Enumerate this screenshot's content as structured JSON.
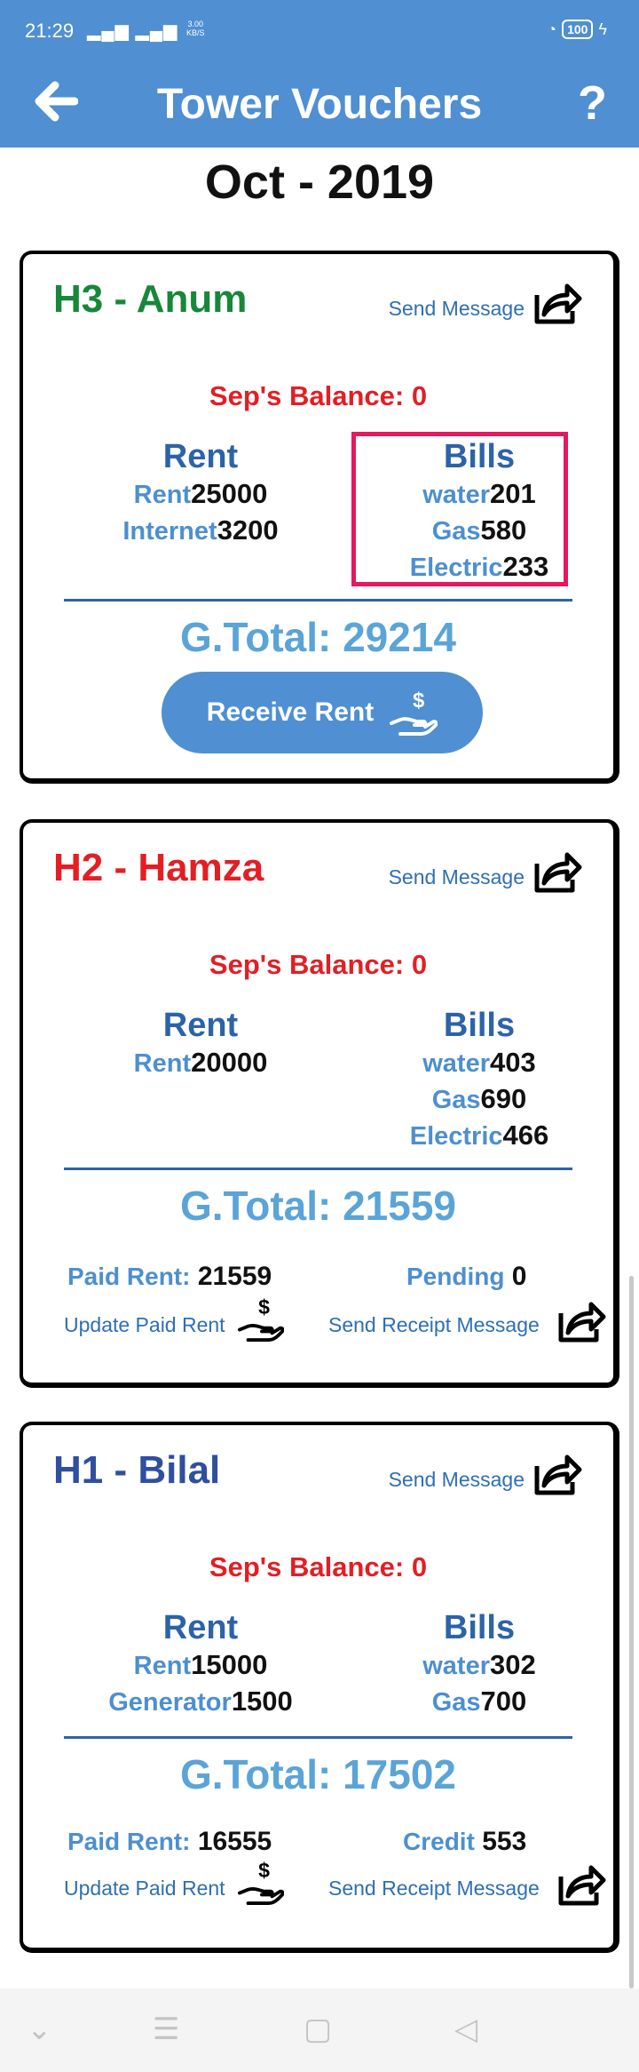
{
  "status_bar": {
    "time": "21:29",
    "speed_value": "3.00",
    "speed_unit": "KB/S",
    "battery": "100"
  },
  "app_bar": {
    "title": "Tower Vouchers",
    "back_icon": "arrow-left-icon",
    "help_label": "?"
  },
  "month": "Oct - 2019",
  "colors": {
    "primary": "#4f8fd2",
    "balance_red": "#e31e24",
    "heading_blue": "#2c63a8",
    "total_blue": "#5aa4d8",
    "highlight": "#e5195c"
  },
  "cards": [
    {
      "name": "H3 - Anum",
      "name_color": "#17873a",
      "send_message": "Send Message",
      "balance": "Sep's Balance: 0",
      "rent_head": "Rent",
      "bills_head": "Bills",
      "rent_items": [
        {
          "label": "Rent",
          "value": "25000"
        },
        {
          "label": "Internet",
          "value": "3200"
        }
      ],
      "bill_items": [
        {
          "label": "water",
          "value": "201"
        },
        {
          "label": "Gas",
          "value": "580"
        },
        {
          "label": "Electric",
          "value": "233"
        }
      ],
      "total": "G.Total: 29214",
      "receive_button": "Receive Rent"
    },
    {
      "name": "H2 - Hamza",
      "name_color": "#e31e24",
      "send_message": "Send Message",
      "balance": "Sep's Balance: 0",
      "rent_head": "Rent",
      "bills_head": "Bills",
      "rent_items": [
        {
          "label": "Rent",
          "value": "20000"
        }
      ],
      "bill_items": [
        {
          "label": "water",
          "value": "403"
        },
        {
          "label": "Gas",
          "value": "690"
        },
        {
          "label": "Electric",
          "value": "466"
        }
      ],
      "total": "G.Total: 21559",
      "paid_label": "Paid Rent:",
      "paid_value": "21559",
      "status_label": "Pending",
      "status_value": "0",
      "update_link": "Update Paid Rent",
      "receipt_link": "Send Receipt Message"
    },
    {
      "name": "H1 - Bilal",
      "name_color": "#2f4f9e",
      "send_message": "Send Message",
      "balance": "Sep's Balance: 0",
      "rent_head": "Rent",
      "bills_head": "Bills",
      "rent_items": [
        {
          "label": "Rent",
          "value": "15000"
        },
        {
          "label": "Generator",
          "value": "1500"
        }
      ],
      "bill_items": [
        {
          "label": "water",
          "value": "302"
        },
        {
          "label": "Gas",
          "value": "700"
        }
      ],
      "total": "G.Total: 17502",
      "paid_label": "Paid Rent:",
      "paid_value": "16555",
      "status_label": "Credit",
      "status_value": "553",
      "update_link": "Update Paid Rent",
      "receipt_link": "Send Receipt Message"
    }
  ]
}
